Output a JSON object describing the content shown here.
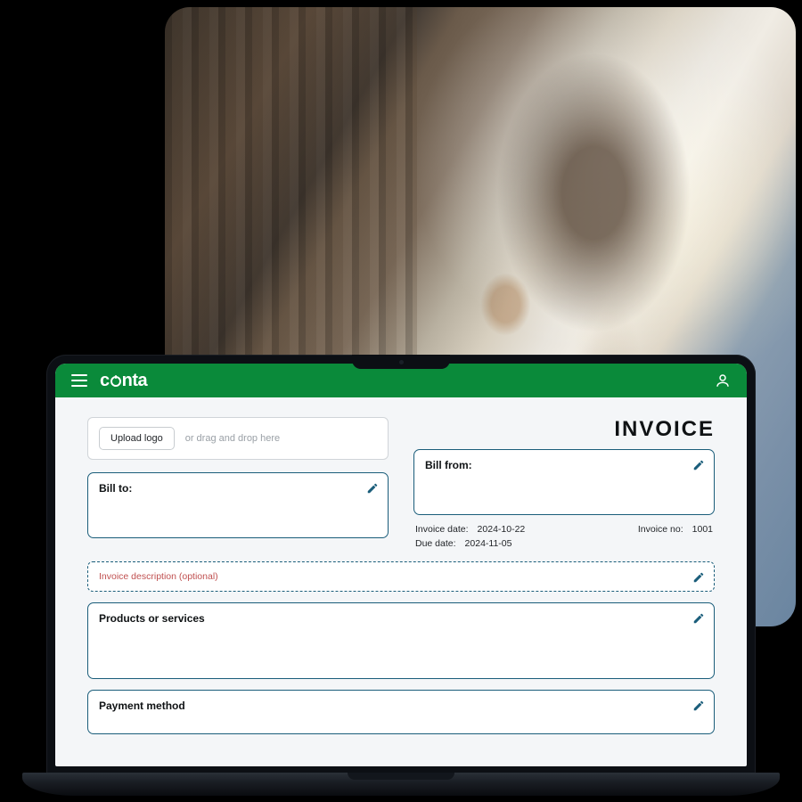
{
  "brand": "conta",
  "header": {
    "menu_icon": "menu-icon",
    "user_icon": "user-icon"
  },
  "upload": {
    "button_label": "Upload logo",
    "hint": "or drag and drop here"
  },
  "invoice": {
    "title": "INVOICE",
    "bill_to_label": "Bill to:",
    "bill_from_label": "Bill from:",
    "invoice_date_label": "Invoice date:",
    "invoice_date_value": "2024-10-22",
    "due_date_label": "Due date:",
    "due_date_value": "2024-11-05",
    "invoice_no_label": "Invoice no:",
    "invoice_no_value": "1001",
    "description_placeholder": "Invoice description (optional)",
    "products_label": "Products or services",
    "payment_label": "Payment method"
  },
  "colors": {
    "brand_green": "#0a8a3a",
    "field_border": "#1a5d7a"
  }
}
